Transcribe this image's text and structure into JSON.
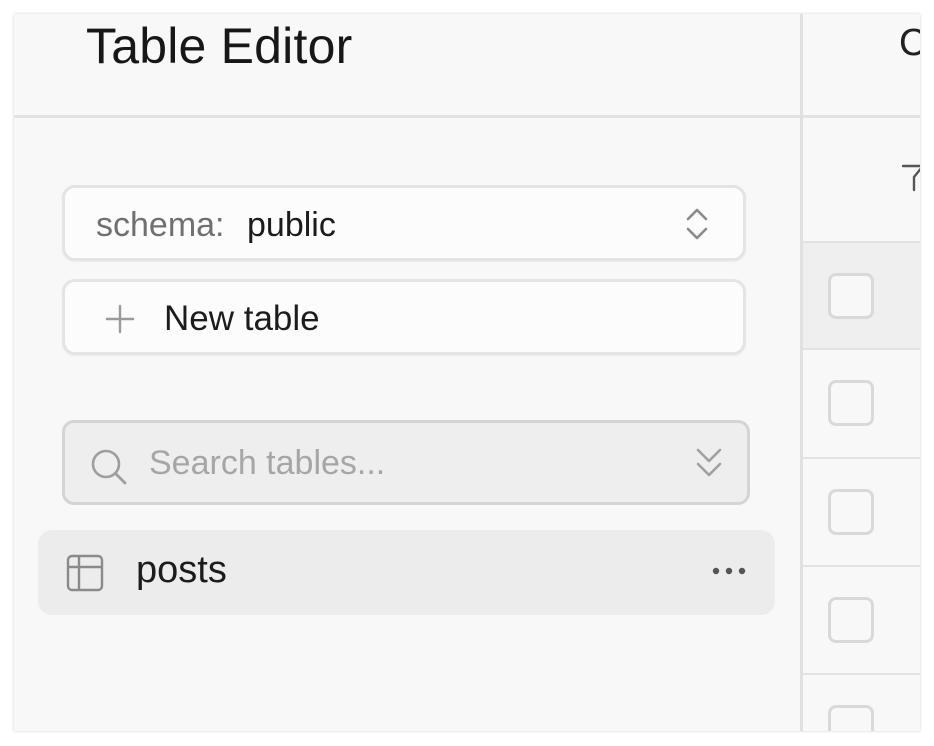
{
  "header": {
    "title": "Table Editor"
  },
  "schema_selector": {
    "prefix": "schema:",
    "value": "public",
    "icon": "chevrons-up-down-icon"
  },
  "new_table": {
    "label": "New table",
    "icon": "plus-icon"
  },
  "search": {
    "placeholder": "Search tables...",
    "value": "",
    "icons": [
      "search-icon",
      "chevrons-down-icon"
    ]
  },
  "tables": [
    {
      "name": "posts",
      "icon": "table-icon",
      "menu_icon": "more-horizontal-icon"
    }
  ],
  "grid": {
    "header_partial": "C",
    "toolbar_icon": "filter-icon",
    "rows": 5,
    "row_checked": [
      false,
      false,
      false,
      false,
      false
    ]
  },
  "colors": {
    "background": "#f8f8f8",
    "selected_item": "#ececec",
    "border": "#e2e2e2",
    "text_primary": "#1c1c1c",
    "text_muted": "#707070",
    "placeholder": "#a6a6a6"
  }
}
